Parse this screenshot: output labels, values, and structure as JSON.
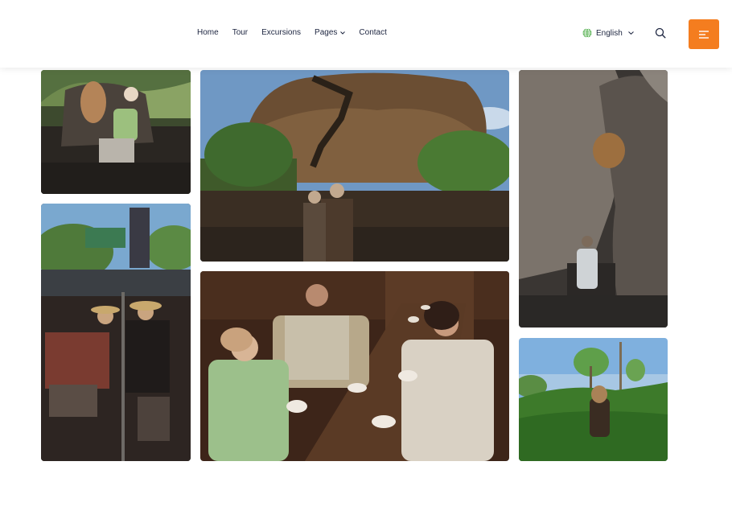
{
  "nav": {
    "items": [
      {
        "label": "Home",
        "has_dropdown": false
      },
      {
        "label": "Tour",
        "has_dropdown": false
      },
      {
        "label": "Excursions",
        "has_dropdown": false
      },
      {
        "label": "Pages",
        "has_dropdown": true
      },
      {
        "label": "Contact",
        "has_dropdown": false
      }
    ]
  },
  "language": {
    "label": "English",
    "icon": "globe-icon"
  },
  "icons": {
    "search": "search-icon",
    "menu": "menu-icon"
  },
  "colors": {
    "accent": "#f47d1f",
    "nav_text": "#1d2540",
    "globe": "#5fb55a"
  },
  "gallery": [
    {
      "subject": "elephant-ride"
    },
    {
      "subject": "sigiriya-rock"
    },
    {
      "subject": "rock-cave-path"
    },
    {
      "subject": "tuk-tuk-ride"
    },
    {
      "subject": "family-tea-room"
    },
    {
      "subject": "tea-plantation"
    }
  ]
}
